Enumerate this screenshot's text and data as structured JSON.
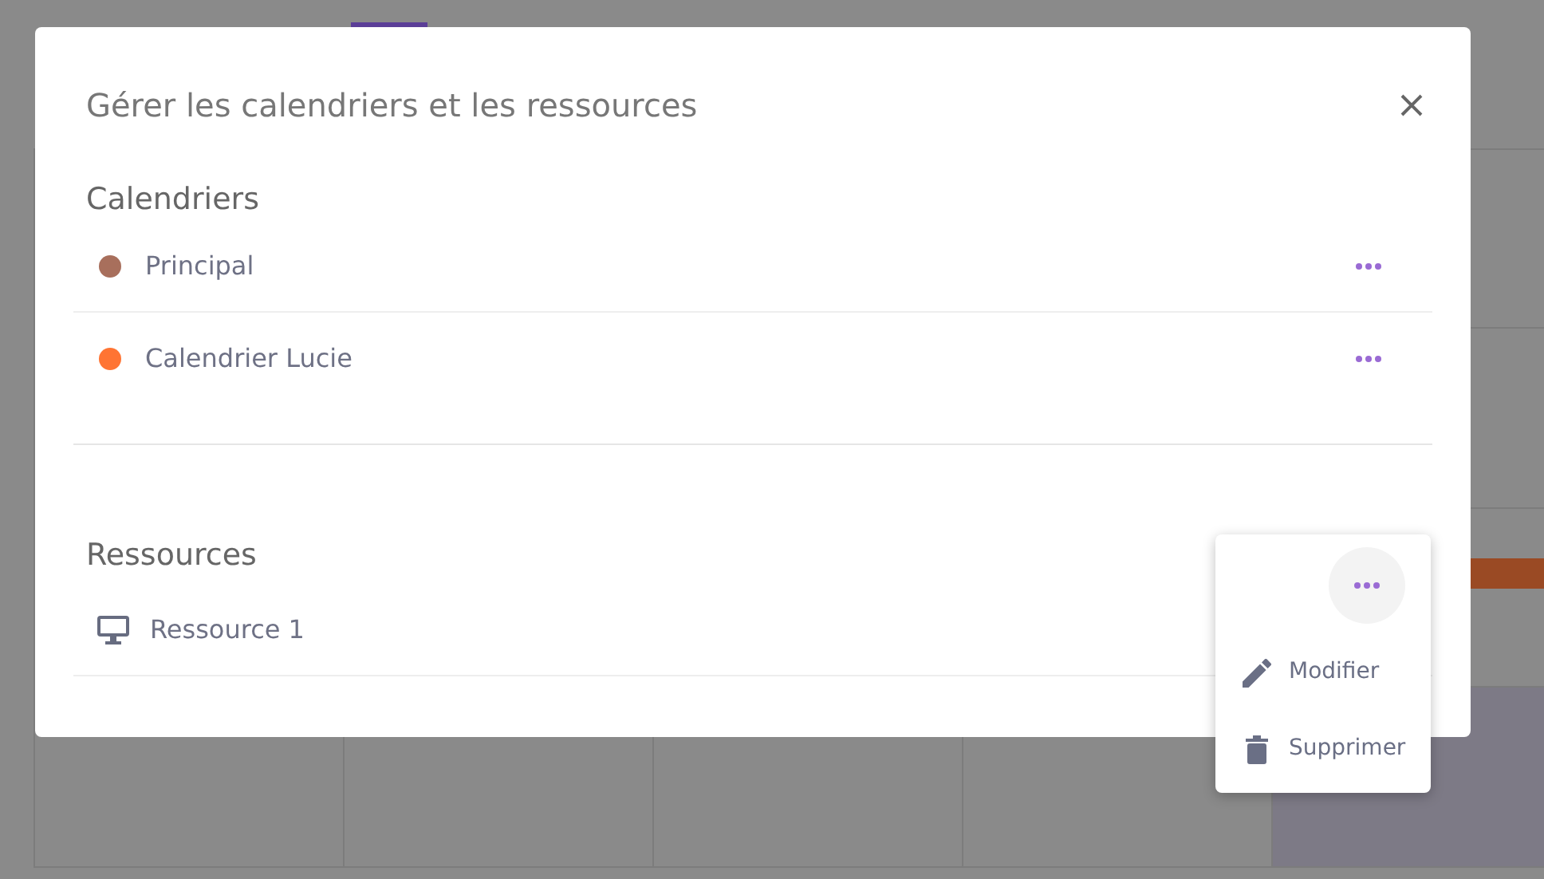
{
  "dialog": {
    "title": "Gérer les calendriers et les ressources",
    "sections": [
      {
        "heading": "Calendriers",
        "items": [
          {
            "kind": "calendar",
            "label": "Principal",
            "color": "#a86f5c",
            "menu_open": false
          },
          {
            "kind": "calendar",
            "label": "Calendrier Lucie",
            "color": "#ff7433",
            "menu_open": false
          }
        ]
      },
      {
        "heading": "Ressources",
        "items": [
          {
            "kind": "resource",
            "label": "Ressource 1",
            "menu_open": true
          }
        ]
      }
    ]
  },
  "menu": {
    "items": [
      {
        "kind": "edit",
        "label": "Modifier"
      },
      {
        "kind": "delete",
        "label": "Supprimer"
      }
    ]
  }
}
